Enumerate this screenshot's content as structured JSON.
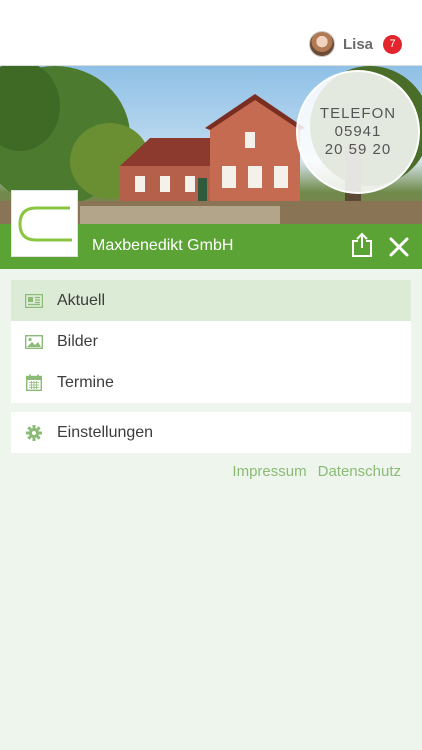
{
  "user": {
    "name": "Lisa",
    "notification_count": "7"
  },
  "hero": {
    "phone_label": "TELEFON",
    "phone_line1": "05941",
    "phone_line2": "20 59 20"
  },
  "company": {
    "name": "Maxbenedikt GmbH"
  },
  "menu": {
    "main": [
      {
        "label": "Aktuell",
        "icon": "newspaper-icon",
        "active": true
      },
      {
        "label": "Bilder",
        "icon": "image-icon",
        "active": false
      },
      {
        "label": "Termine",
        "icon": "calendar-icon",
        "active": false
      }
    ],
    "settings": {
      "label": "Einstellungen",
      "icon": "gear-icon"
    }
  },
  "footer": {
    "impressum": "Impressum",
    "datenschutz": "Datenschutz"
  },
  "colors": {
    "accent": "#5ba335",
    "active_bg": "#dcebd6",
    "link": "#8bbb76",
    "badge": "#e3262d",
    "page_bg": "#eef5ec"
  }
}
